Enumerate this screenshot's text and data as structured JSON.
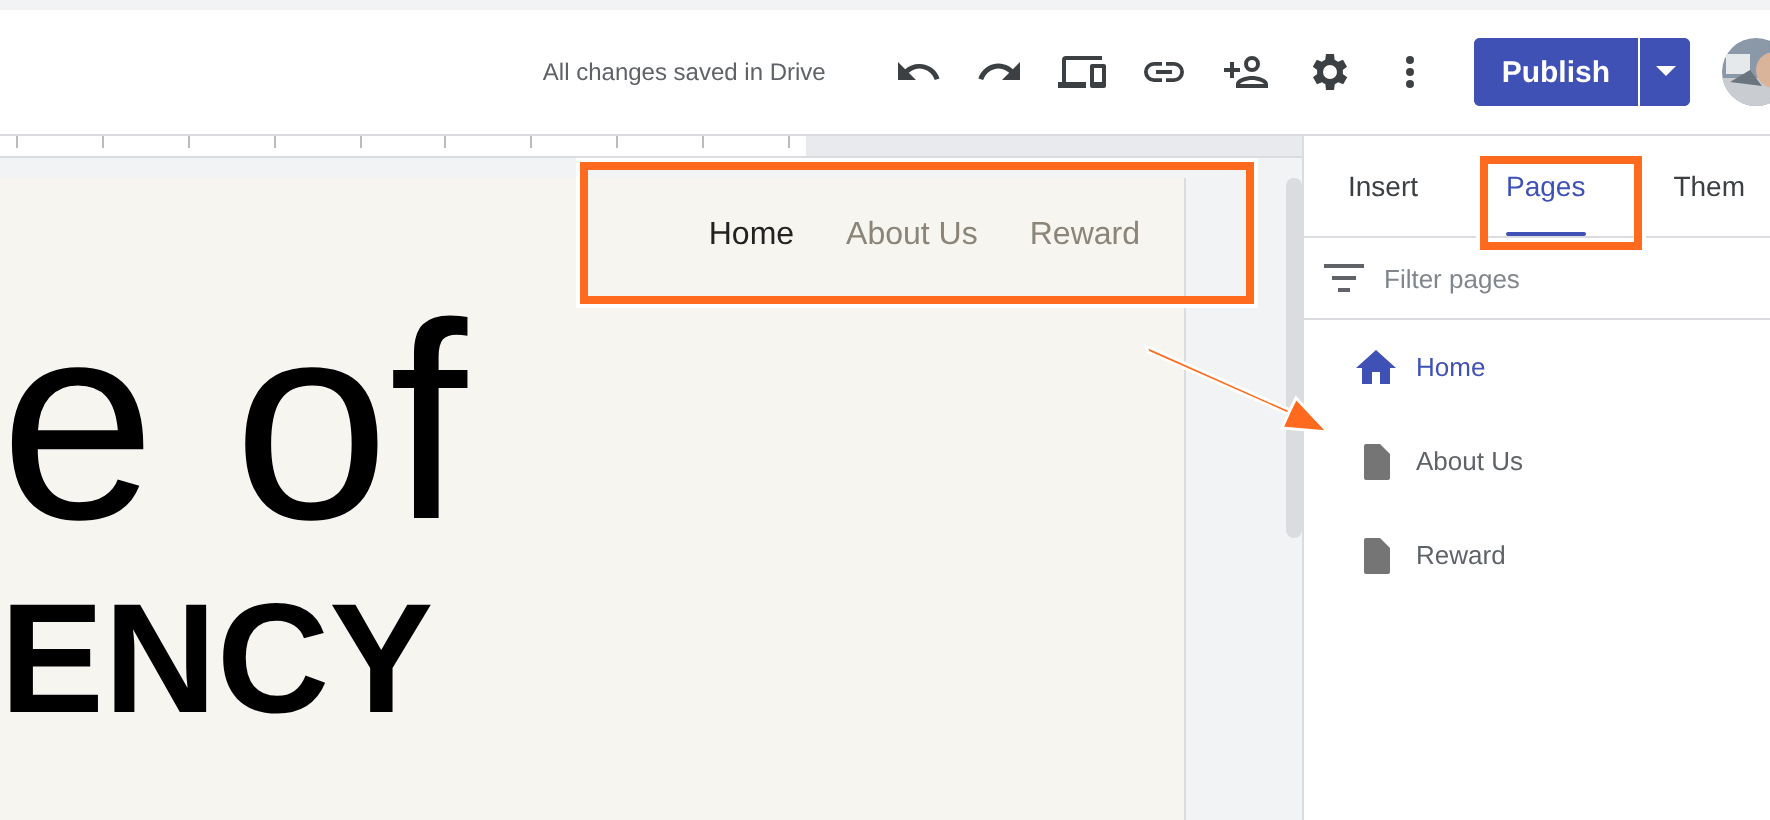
{
  "toolbar": {
    "save_status": "All changes saved in Drive",
    "publish_button": "Publish"
  },
  "site_nav": [
    {
      "label": "Home",
      "selected": true
    },
    {
      "label": "About Us",
      "selected": false
    },
    {
      "label": "Reward",
      "selected": false
    }
  ],
  "canvas_text": [
    "e of",
    "ENCY"
  ],
  "panel": {
    "tabs": [
      {
        "label": "Insert",
        "selected": false
      },
      {
        "label": "Pages",
        "selected": true
      },
      {
        "label": "Them",
        "selected": false
      }
    ],
    "filter": {
      "placeholder": "Filter pages"
    },
    "pages": [
      {
        "label": "Home",
        "kind": "home",
        "selected": true
      },
      {
        "label": "About Us",
        "kind": "page",
        "selected": false
      },
      {
        "label": "Reward",
        "kind": "page",
        "selected": false
      }
    ]
  }
}
